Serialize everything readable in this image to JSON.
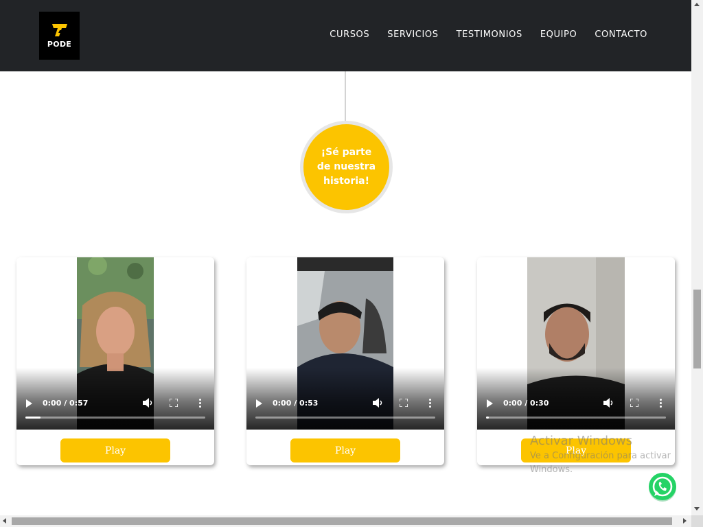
{
  "header": {
    "logo_text": "PODE",
    "nav": [
      "CURSOS",
      "SERVICIOS",
      "TESTIMONIOS",
      "EQUIPO",
      "CONTACTO"
    ]
  },
  "timeline": {
    "badge_text": "¡Sé parte de nuestra historia!"
  },
  "videos": [
    {
      "time": "0:00 / 0:57",
      "button_label": "Play"
    },
    {
      "time": "0:00 / 0:53",
      "button_label": "Play"
    },
    {
      "time": "0:00 / 0:30",
      "button_label": "Play"
    }
  ],
  "watermark": {
    "title": "Activar Windows",
    "subtitle": "Ve a Configuración para activar Windows."
  },
  "icons": {
    "whatsapp": "whatsapp-icon",
    "play": "play-icon",
    "volume": "volume-icon",
    "fullscreen": "fullscreen-icon",
    "more": "more-options-icon"
  },
  "colors": {
    "header_bg": "#222427",
    "accent": "#fcc400",
    "whatsapp": "#25d366"
  }
}
